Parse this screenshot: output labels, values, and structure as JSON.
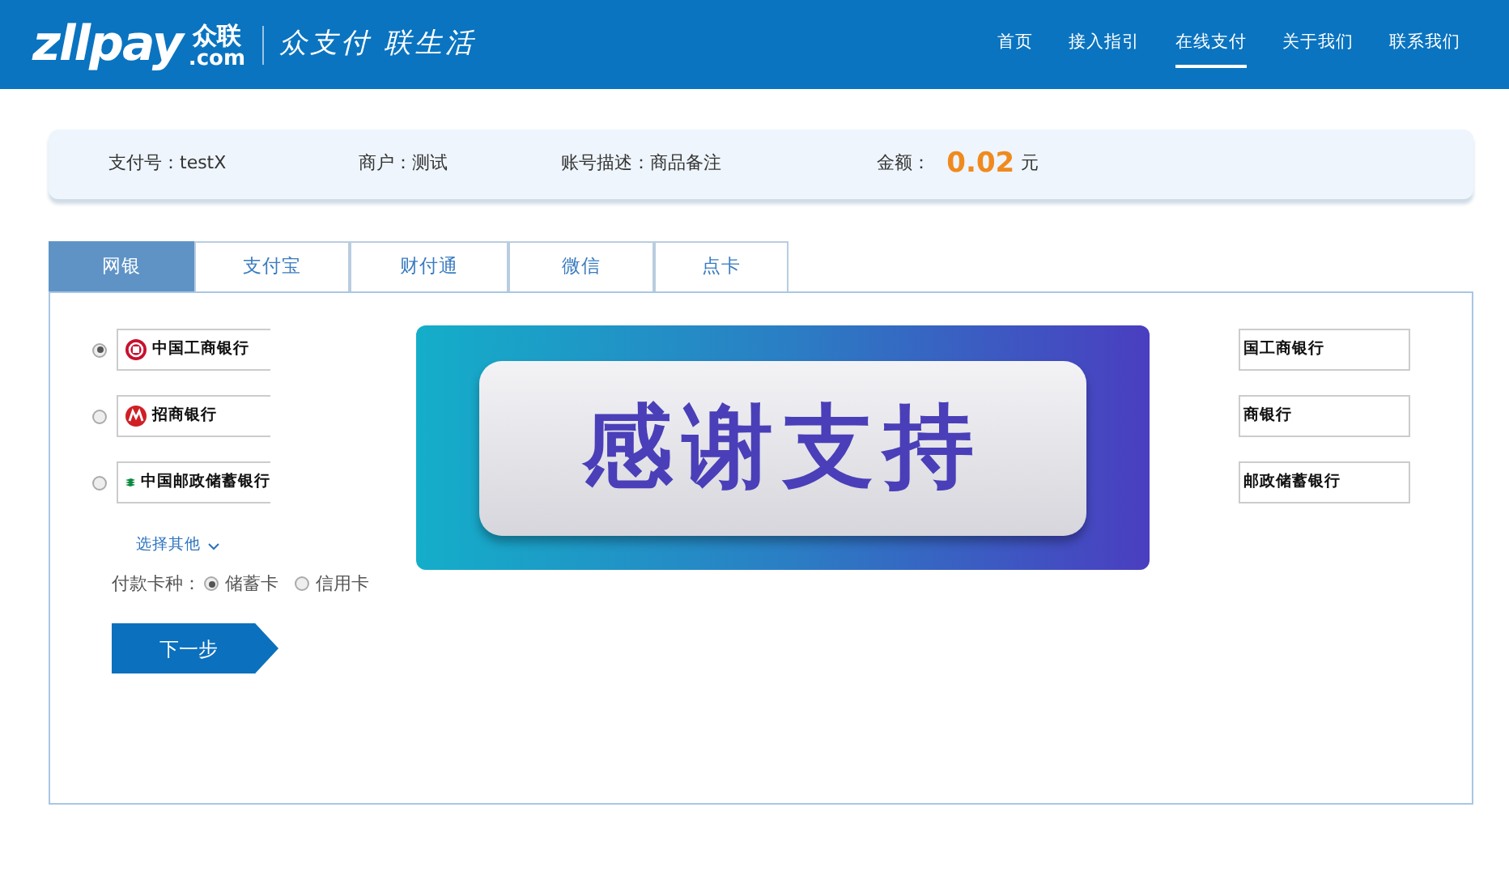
{
  "header": {
    "brand": "zllpay",
    "sub_brand": "众联",
    "domain": ".com",
    "slogan": "众支付 联生活",
    "nav": [
      {
        "label": "首页",
        "selected": false
      },
      {
        "label": "接入指引",
        "selected": false
      },
      {
        "label": "在线支付",
        "selected": true
      },
      {
        "label": "关于我们",
        "selected": false
      },
      {
        "label": "联系我们",
        "selected": false
      }
    ]
  },
  "info": [
    {
      "label": "支付号：",
      "value": "testX"
    },
    {
      "label": "商户：",
      "value": "测试"
    },
    {
      "label": "账号描述：",
      "value": "商品备注"
    }
  ],
  "amount": {
    "label": "金额：",
    "value": "0.02",
    "unit": "元"
  },
  "tabs": [
    {
      "label": "网银",
      "selected": true
    },
    {
      "label": "支付宝",
      "selected": false
    },
    {
      "label": "财付通",
      "selected": false
    },
    {
      "label": "微信",
      "selected": false
    },
    {
      "label": "点卡",
      "selected": false
    }
  ],
  "banks": [
    {
      "kind": "icbc",
      "name": "中国工商银行",
      "right_name": "国工商银行",
      "selected": true
    },
    {
      "kind": "cmb",
      "name": "招商银行",
      "right_name": "商银行",
      "selected": false
    },
    {
      "kind": "psbc",
      "name": "中国邮政储蓄银行",
      "right_name": "邮政储蓄银行",
      "selected": false
    }
  ],
  "more_link": "选择其他",
  "card_type": {
    "label": "付款卡种：",
    "options": [
      {
        "label": "储蓄卡",
        "selected": true
      },
      {
        "label": "信用卡",
        "selected": false
      }
    ]
  },
  "next_button": "下一步",
  "overlay": {
    "text": "感谢支持"
  }
}
